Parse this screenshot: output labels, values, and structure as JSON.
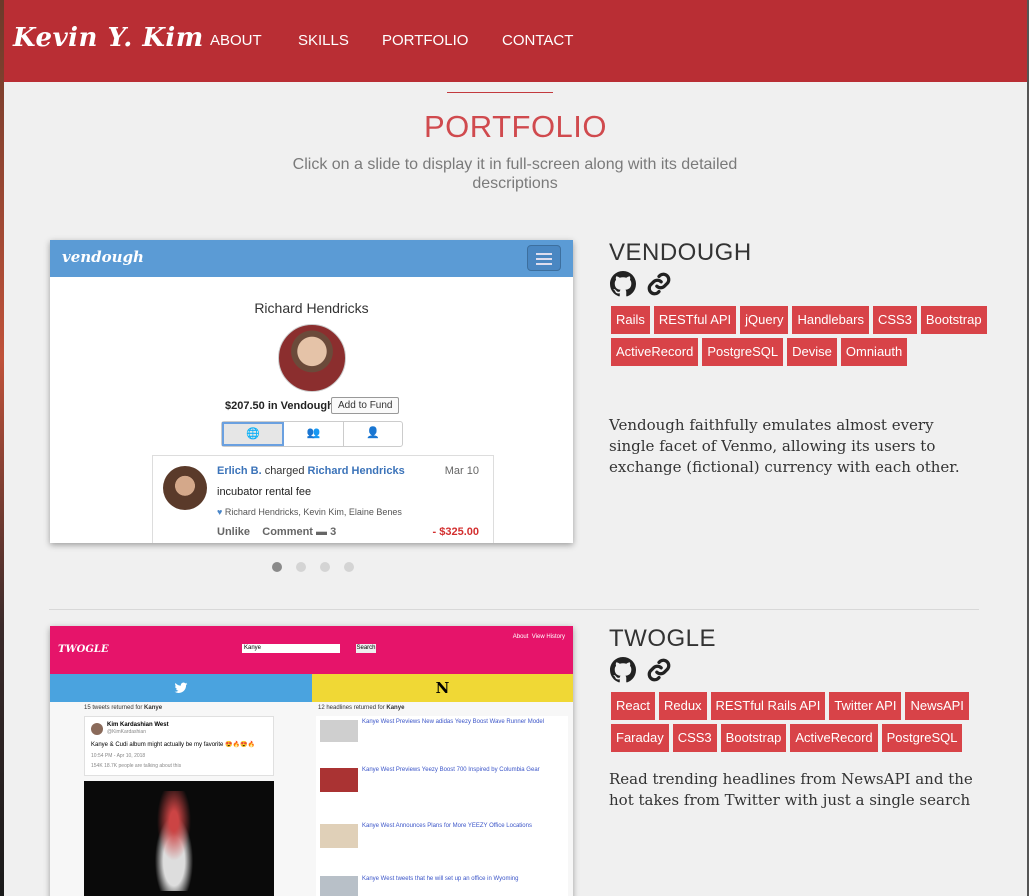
{
  "nav": {
    "brand": "Kevin Y. Kim",
    "links": [
      "ABOUT",
      "SKILLS",
      "PORTFOLIO",
      "CONTACT"
    ]
  },
  "portfolio": {
    "title": "PORTFOLIO",
    "subtitle": "Click on a slide to display it in full-screen along with its detailed descriptions"
  },
  "projects": [
    {
      "title": "VENDOUGH",
      "tags": [
        "Rails",
        "RESTful API",
        "jQuery",
        "Handlebars",
        "CSS3",
        "Bootstrap",
        "ActiveRecord",
        "PostgreSQL",
        "Devise",
        "Omniauth"
      ],
      "description": "Vendough faithfully emulates almost every single facet of Venmo, allowing its users to exchange (fictional) currency with each other.",
      "icons": [
        "github-icon",
        "link-icon"
      ],
      "slides_total": 4,
      "slide_active": 1,
      "screenshot": {
        "logo": "vendough",
        "user_name": "Richard Hendricks",
        "balance": "$207.50 in Vendough",
        "fund_button": "Add to Fund",
        "txn_actor": "Erlich B.",
        "txn_verb": "charged",
        "txn_target": "Richard Hendricks",
        "txn_date": "Mar 10",
        "txn_note": "incubator rental fee",
        "txn_likes": "Richard Hendricks, Kevin Kim, Elaine Benes",
        "txn_unlike": "Unlike",
        "txn_comment": "Comment",
        "txn_comment_count": "3",
        "txn_amount": "- $325.00"
      }
    },
    {
      "title": "TWOGLE",
      "tags": [
        "React",
        "Redux",
        "RESTful Rails API",
        "Twitter API",
        "NewsAPI",
        "Faraday",
        "CSS3",
        "Bootstrap",
        "ActiveRecord",
        "PostgreSQL"
      ],
      "description": "Read trending headlines from NewsAPI and the hot takes from Twitter with just a single search",
      "icons": [
        "github-icon",
        "link-icon"
      ],
      "screenshot": {
        "logo": "TWOGLE",
        "nav_about": "About",
        "nav_history": "View History",
        "search_value": "Kanye",
        "search_button": "Search",
        "news_letter": "N",
        "tweets_count_label": "15 tweets returned for",
        "headlines_count_label": "12 headlines returned for",
        "query": "Kanye",
        "tweet_author": "Kim Kardashian West",
        "tweet_handle": "@KimKardashian",
        "tweet_text": "Kanye & Cudi album might actually be my favorite 😍🔥😍🔥",
        "tweet_time": "10:54 PM - Apr 10, 2018",
        "tweet_stats": "154K  18.7K people are talking about this",
        "headlines": [
          "Kanye West Previews New adidas Yeezy Boost Wave Runner Model",
          "Kanye West Previews Yeezy Boost 700 Inspired by Columbia Gear",
          "Kanye West Announces Plans for More YEEZY Office Locations",
          "Kanye West tweets that he will set up an office in Wyoming"
        ]
      }
    }
  ]
}
